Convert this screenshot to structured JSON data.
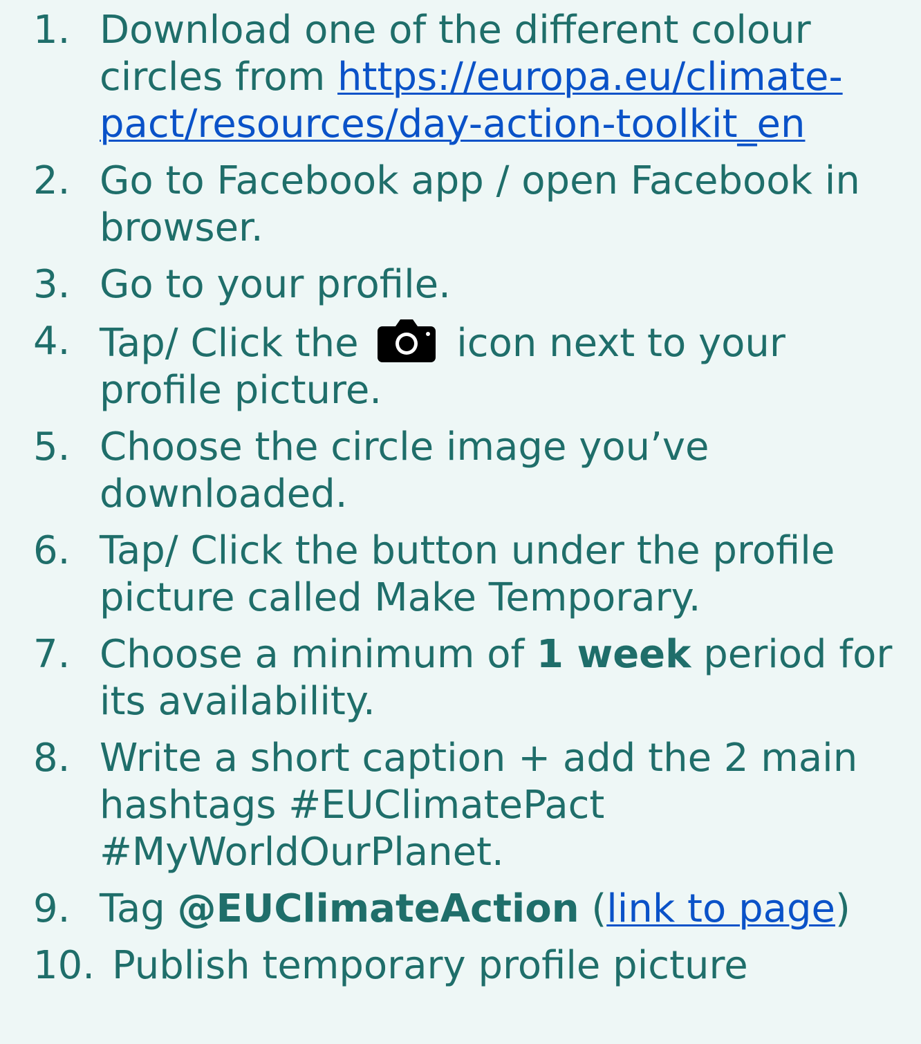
{
  "document": {
    "steps": [
      {
        "number": "1.",
        "text_before": "Download one of the different colour circles from ",
        "link_text": "https://europa.eu/climate-pact/resources/day-action-toolkit_en"
      },
      {
        "number": "2.",
        "text": "Go to Facebook app / open Facebook in browser."
      },
      {
        "number": "3.",
        "text": "Go to your profile."
      },
      {
        "number": "4.",
        "text_before": "Tap/ Click the ",
        "icon": "camera-icon",
        "text_after": " icon next to your profile picture."
      },
      {
        "number": "5.",
        "text": "Choose the circle image you’ve downloaded."
      },
      {
        "number": "6.",
        "text": "Tap/ Click the button under the profile picture called Make Temporary."
      },
      {
        "number": "7.",
        "text_before": "Choose a minimum of ",
        "bold_text": "1 week",
        "text_after": " period for its availability."
      },
      {
        "number": "8.",
        "text": "Write a short caption + add the 2 main hashtags #EUClimatePact #MyWorldOurPlanet."
      },
      {
        "number": "9.",
        "text_before": "Tag ",
        "bold_text": "@EUClimateAction",
        "text_middle": " (",
        "link_text": "link to page",
        "text_after": ")"
      },
      {
        "number": "10.",
        "text": "Publish temporary profile picture"
      }
    ]
  },
  "colors": {
    "background": "#eef7f6",
    "text": "#1f6e6a",
    "link": "#0a52c8",
    "icon": "#000000"
  }
}
